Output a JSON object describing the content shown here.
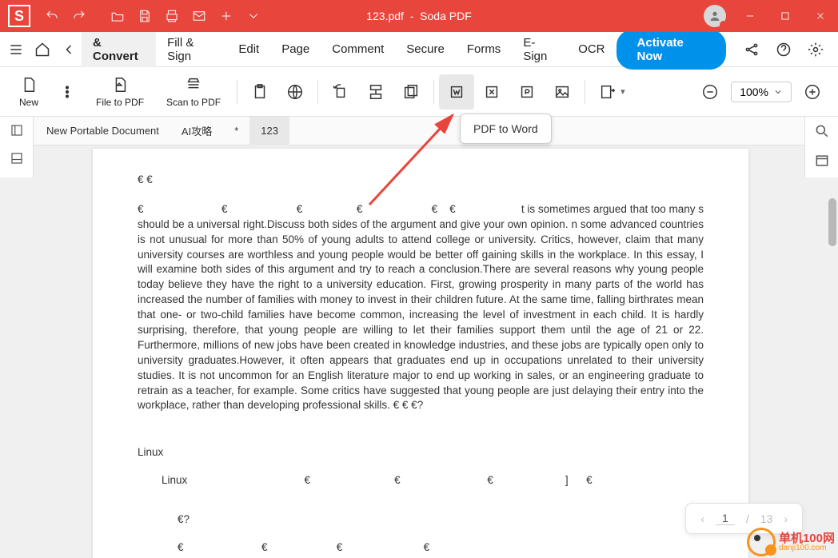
{
  "title": {
    "filename": "123.pdf",
    "app": "Soda PDF"
  },
  "menu": {
    "active": "& Convert",
    "items": [
      "& Convert",
      "Fill & Sign",
      "Edit",
      "Page",
      "Comment",
      "Secure",
      "Forms",
      "E-Sign",
      "OCR"
    ],
    "activate": "Activate Now"
  },
  "toolbar": {
    "new": "New",
    "file2pdf": "File to PDF",
    "scan2pdf": "Scan to PDF",
    "zoom": "100%"
  },
  "tooltip": "PDF to Word",
  "tabs": {
    "items": [
      "New Portable Document",
      "AI攻略",
      "*",
      "123"
    ],
    "activeIndex": 3
  },
  "doc": {
    "euros1": "€    €",
    "euros2": "€                          €                       €                  €                       €    €",
    "frag1": "t is sometimes argued that too many s",
    "body": "should be a universal right.Discuss both sides of the argument and give your own opinion.                  n some advanced countries is not unusual for more than 50% of young adults to attend college or university. Critics, however, claim that many university courses are worthless and young people would be better off gaining skills in the workplace. In this essay, I will examine both sides of this argument and try to reach a conclusion.There are several reasons why young people today believe they have the right to a university education. First, growing prosperity in many parts of the world has increased the number of families with money to invest in their children   future. At the same time, falling birthrates mean that one- or two-child families have become common, increasing the level of investment in each child. It is hardly surprising, therefore, that young people are willing to let their families support them until the age of 21 or 22. Furthermore, millions of new jobs have been created in knowledge industries, and these jobs are typically open only to university graduates.However, it often appears that graduates end up in occupations unrelated to their university studies. It is not uncommon for an English literature major to end up working in sales, or an engineering graduate to retrain as a teacher, for example. Some critics have suggested that young people are just delaying their entry into the workplace, rather than developing professional skills.                              €            €        €?",
    "linux1": "Linux",
    "linux2": "Linux                                       €                            €                             €                        ]      €",
    "euros3": "€?",
    "euros4": "€                          €                       €                           €"
  },
  "pager": {
    "current": "1",
    "total": "13"
  },
  "watermark": {
    "t1": "单机100网",
    "t2": "danji100.com"
  }
}
